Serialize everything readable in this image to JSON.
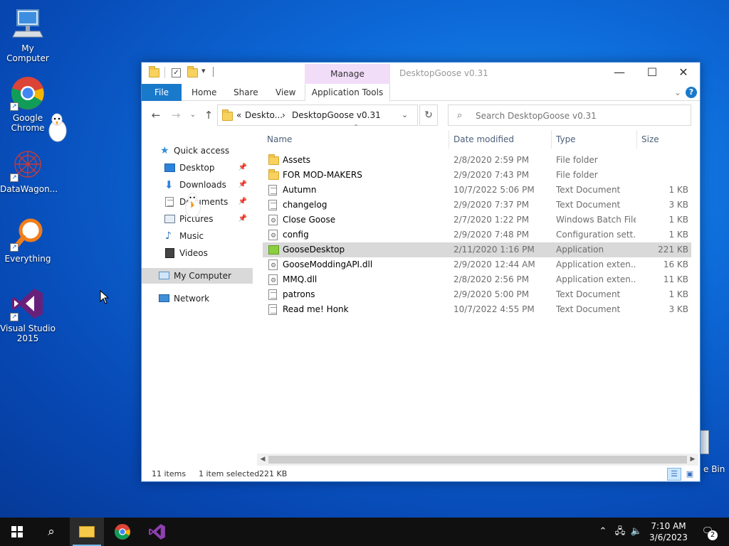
{
  "desktop": {
    "icons": [
      {
        "label": "My Computer"
      },
      {
        "label": "Google Chrome"
      },
      {
        "label": "DataWagon..."
      },
      {
        "label": "Everything"
      },
      {
        "label": "Visual Studio 2015"
      }
    ],
    "recycle_bin_label_fragment": "e Bin"
  },
  "window": {
    "title": "DesktopGoose v0.31",
    "manage_tab": "Manage",
    "ribbon_tabs": [
      "File",
      "Home",
      "Share",
      "View",
      "Application Tools"
    ],
    "address": {
      "crumbs": [
        "«",
        "Deskto...",
        "›",
        "DesktopGoose v0.31"
      ]
    },
    "search_placeholder": "Search DesktopGoose v0.31",
    "nav_pane": [
      {
        "label": "Quick access",
        "icon": "star-icon"
      },
      {
        "label": "Desktop",
        "icon": "desktop-icon",
        "pinned": true
      },
      {
        "label": "Downloads",
        "icon": "download-icon",
        "pinned": true
      },
      {
        "label": "Documents",
        "icon": "documents-icon",
        "pinned": true
      },
      {
        "label": "Pictures",
        "icon": "pictures-icon",
        "pinned": true
      },
      {
        "label": "Music",
        "icon": "music-icon"
      },
      {
        "label": "Videos",
        "icon": "videos-icon"
      },
      {
        "label": "My Computer",
        "icon": "computer-icon",
        "selected": true
      },
      {
        "label": "Network",
        "icon": "network-icon"
      }
    ],
    "columns": [
      "Name",
      "Date modified",
      "Type",
      "Size"
    ],
    "files": [
      {
        "name": "Assets",
        "date": "2/8/2020 2:59 PM",
        "type": "File folder",
        "size": "",
        "icon": "folder-icon"
      },
      {
        "name": "FOR MOD-MAKERS",
        "date": "2/9/2020 7:43 PM",
        "type": "File folder",
        "size": "",
        "icon": "folder-icon"
      },
      {
        "name": "Autumn",
        "date": "10/7/2022 5:06 PM",
        "type": "Text Document",
        "size": "1 KB",
        "icon": "text-file-icon"
      },
      {
        "name": "changelog",
        "date": "2/9/2020 7:37 PM",
        "type": "Text Document",
        "size": "3 KB",
        "icon": "text-file-icon"
      },
      {
        "name": "Close Goose",
        "date": "2/7/2020 1:22 PM",
        "type": "Windows Batch File",
        "size": "1 KB",
        "icon": "batch-file-icon"
      },
      {
        "name": "config",
        "date": "2/9/2020 7:48 PM",
        "type": "Configuration sett...",
        "size": "1 KB",
        "icon": "config-file-icon"
      },
      {
        "name": "GooseDesktop",
        "date": "2/11/2020 1:16 PM",
        "type": "Application",
        "size": "221 KB",
        "icon": "application-icon",
        "selected": true
      },
      {
        "name": "GooseModdingAPI.dll",
        "date": "2/9/2020 12:44 AM",
        "type": "Application exten...",
        "size": "16 KB",
        "icon": "dll-file-icon"
      },
      {
        "name": "MMQ.dll",
        "date": "2/8/2020 2:56 PM",
        "type": "Application exten...",
        "size": "11 KB",
        "icon": "dll-file-icon"
      },
      {
        "name": "patrons",
        "date": "2/9/2020 5:00 PM",
        "type": "Text Document",
        "size": "1 KB",
        "icon": "text-file-icon"
      },
      {
        "name": "Read me! Honk",
        "date": "10/7/2022 4:55 PM",
        "type": "Text Document",
        "size": "3 KB",
        "icon": "text-file-icon"
      }
    ],
    "status": {
      "item_count": "11 items",
      "selection": "1 item selected",
      "selection_size": "221 KB"
    }
  },
  "taskbar": {
    "clock_time": "7:10 AM",
    "clock_date": "3/6/2023",
    "notification_count": "2"
  },
  "colors": {
    "file_tab": "#1979ca",
    "manage_tab": "#f2ddf9",
    "selection": "#d9d9d9",
    "taskbar": "#101010"
  }
}
